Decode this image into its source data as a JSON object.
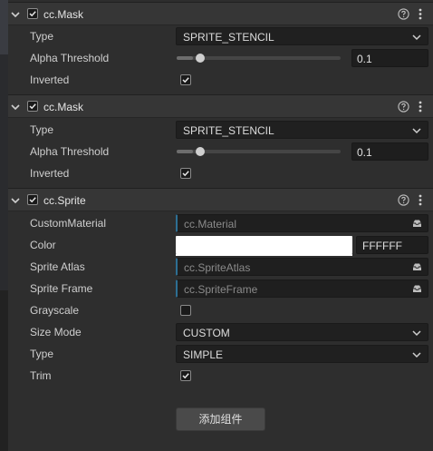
{
  "components": [
    {
      "title": "cc.Mask",
      "enabled": true,
      "rows": {
        "type_label": "Type",
        "type_value": "SPRITE_STENCIL",
        "alpha_label": "Alpha Threshold",
        "alpha_value": "0.1",
        "alpha_fraction": 0.1,
        "inverted_label": "Inverted",
        "inverted": true
      }
    },
    {
      "title": "cc.Mask",
      "enabled": true,
      "rows": {
        "type_label": "Type",
        "type_value": "SPRITE_STENCIL",
        "alpha_label": "Alpha Threshold",
        "alpha_value": "0.1",
        "alpha_fraction": 0.1,
        "inverted_label": "Inverted",
        "inverted": true
      }
    },
    {
      "title": "cc.Sprite",
      "enabled": true,
      "rows": {
        "custom_material_label": "CustomMaterial",
        "custom_material_value": "cc.Material",
        "color_label": "Color",
        "color_hex": "FFFFFF",
        "sprite_atlas_label": "Sprite Atlas",
        "sprite_atlas_value": "cc.SpriteAtlas",
        "sprite_frame_label": "Sprite Frame",
        "sprite_frame_value": "cc.SpriteFrame",
        "grayscale_label": "Grayscale",
        "grayscale": false,
        "size_mode_label": "Size Mode",
        "size_mode_value": "CUSTOM",
        "type_label": "Type",
        "type_value": "SIMPLE",
        "trim_label": "Trim",
        "trim": true
      }
    }
  ],
  "add_component_label": "添加组件",
  "icons": {
    "collapse": "chevron-down-icon",
    "help": "help-circle-icon",
    "more": "more-vertical-icon",
    "asset_picker": "inbox-icon",
    "check": "check-icon"
  },
  "colors": {
    "asset_field_accent": "#2d6f93",
    "panel_bg": "#2e2e2e",
    "header_bg": "#363636"
  }
}
